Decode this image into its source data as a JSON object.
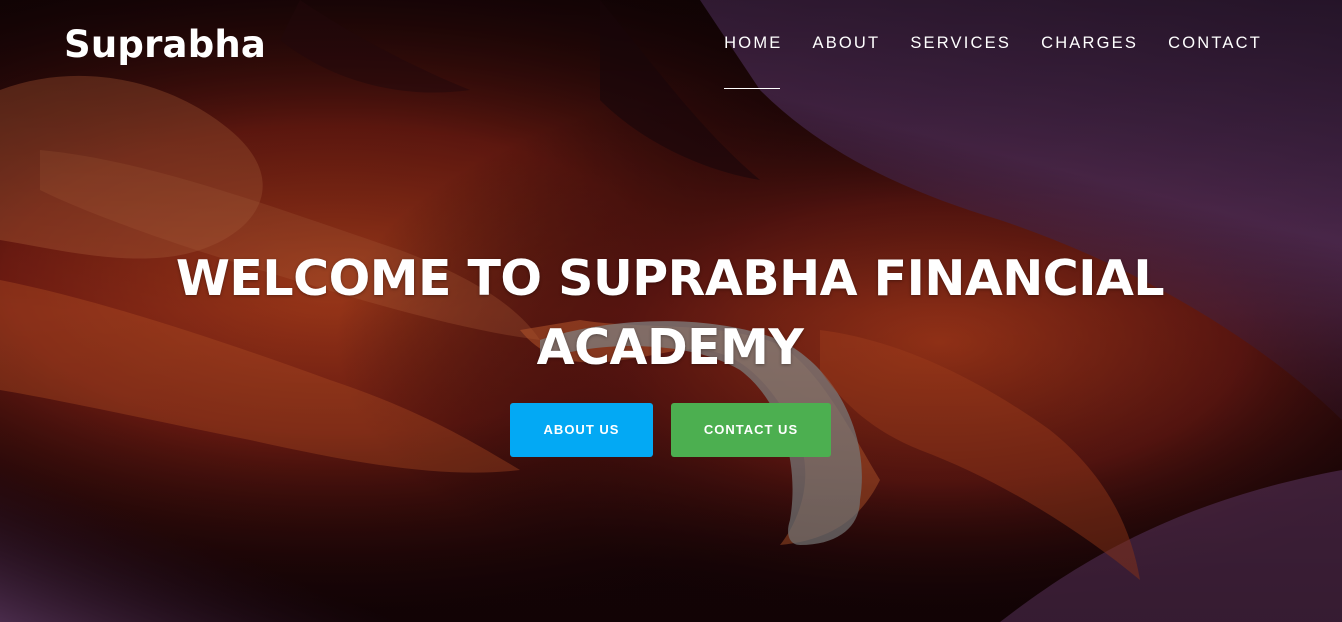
{
  "header": {
    "brand": "Suprabha",
    "nav": [
      {
        "label": "HOME",
        "active": true
      },
      {
        "label": "ABOUT",
        "active": false
      },
      {
        "label": "SERVICES",
        "active": false
      },
      {
        "label": "CHARGES",
        "active": false
      },
      {
        "label": "CONTACT",
        "active": false
      }
    ]
  },
  "hero": {
    "headline_line1": "WELCOME TO SUPRABHA FINANCIAL",
    "headline_line2": "ACADEMY",
    "about_button": "ABOUT US",
    "contact_button": "CONTACT US"
  },
  "colors": {
    "about_button": "#03a9f4",
    "contact_button": "#4caf50",
    "text": "#ffffff"
  }
}
